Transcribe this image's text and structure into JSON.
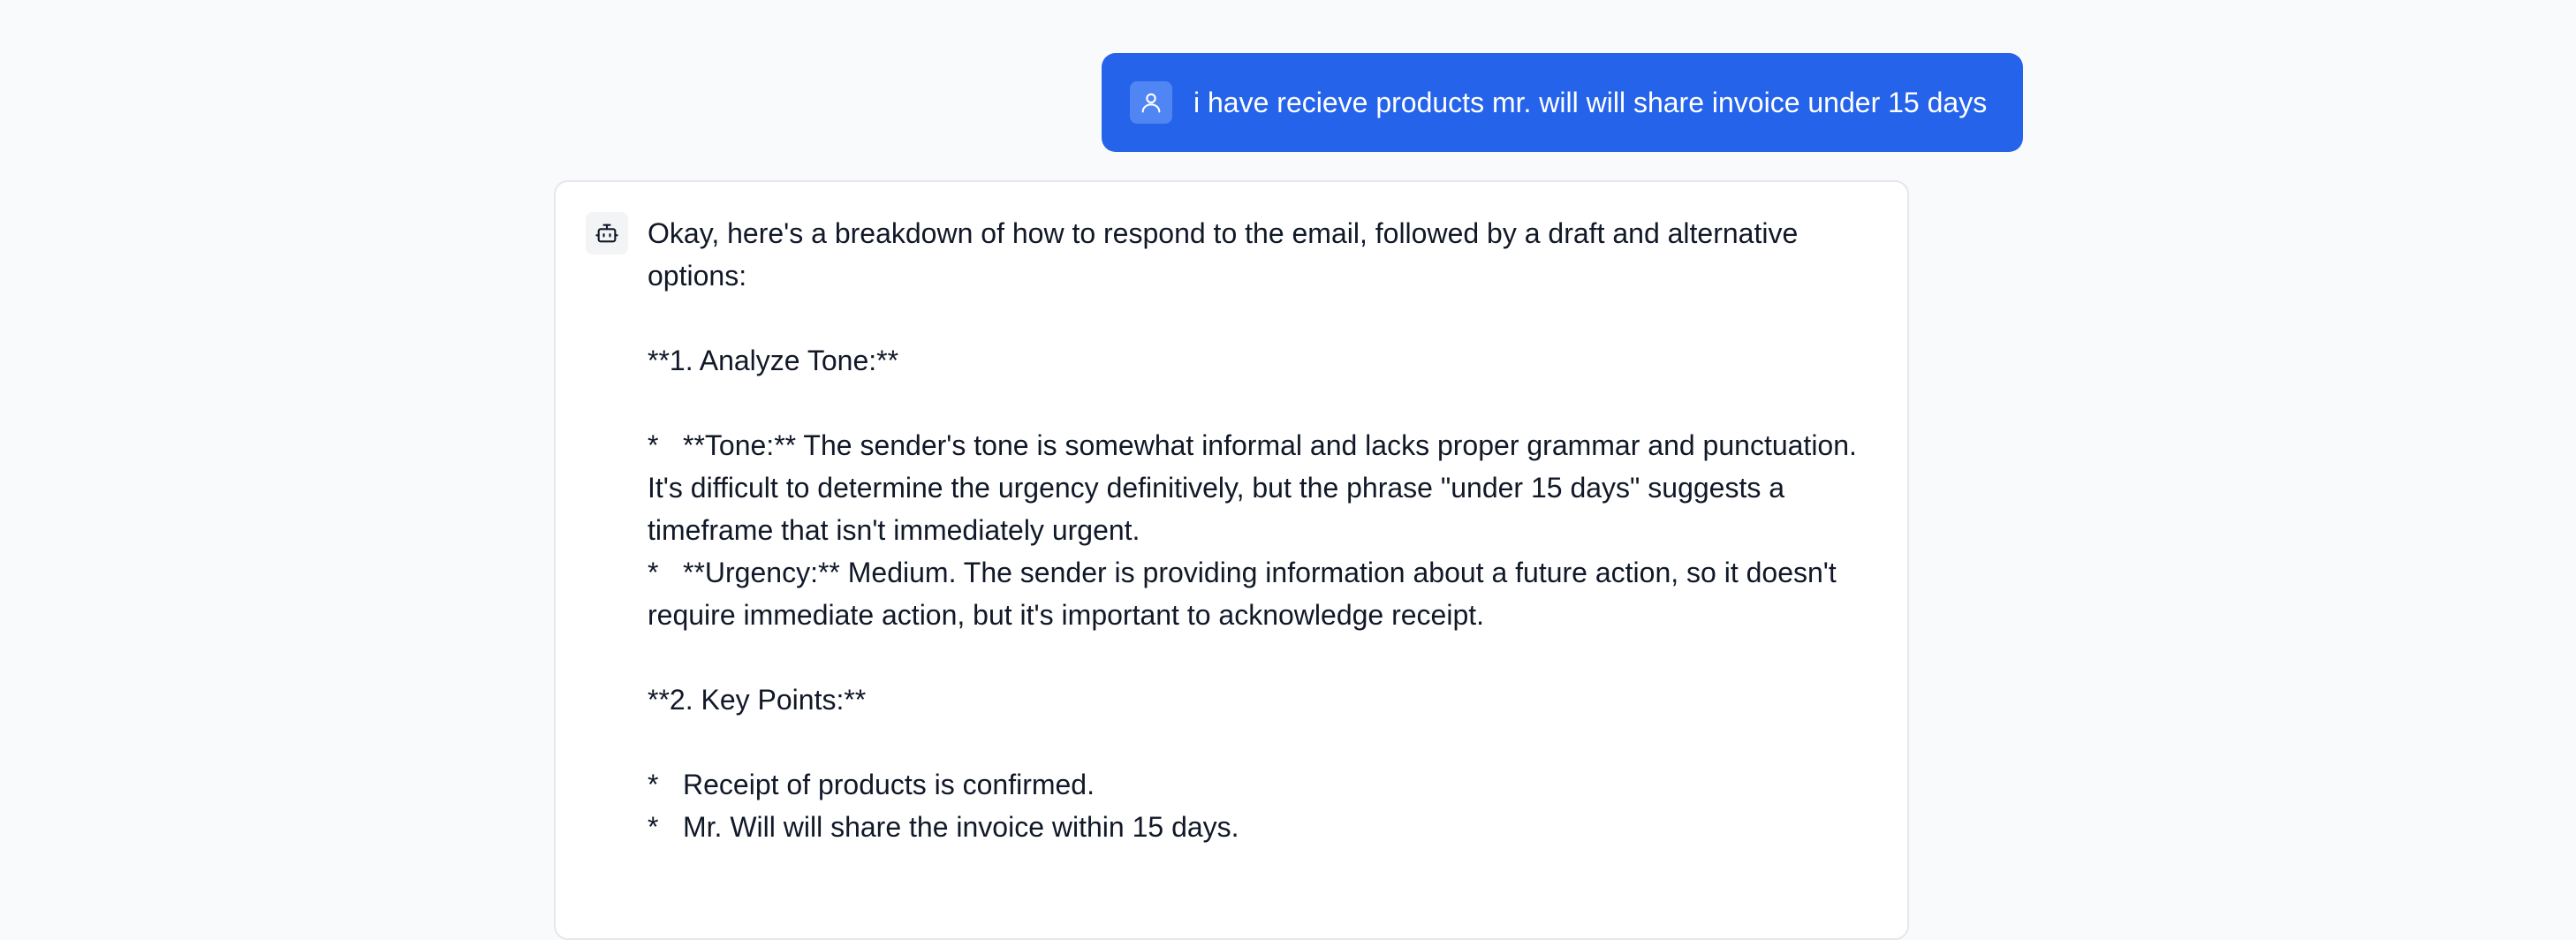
{
  "colors": {
    "user_bubble": "#2563eb",
    "page_background": "#f9fafb",
    "card_background": "#ffffff"
  },
  "icons": {
    "user": "user-icon",
    "bot": "bot-icon"
  },
  "user_message": {
    "text": "i have recieve products mr. will will share invoice under 15 days"
  },
  "assistant_message": {
    "intro": "Okay, here's a breakdown of how to respond to the email, followed by a draft and alternative options:",
    "section1_heading": "**1. Analyze Tone:**",
    "section1_bullets": [
      {
        "mark": "*",
        "text": "**Tone:** The sender's tone is somewhat informal and lacks proper grammar and punctuation. It's difficult to determine the urgency definitively, but the phrase \"under 15 days\" suggests a timeframe that isn't immediately urgent."
      },
      {
        "mark": "*",
        "text": "**Urgency:** Medium. The sender is providing information about a future action, so it doesn't require immediate action, but it's important to acknowledge receipt."
      }
    ],
    "section2_heading": "**2. Key Points:**",
    "section2_bullets": [
      {
        "mark": "*",
        "text": "Receipt of products is confirmed."
      },
      {
        "mark": "*",
        "text": "Mr. Will will share the invoice within 15 days."
      }
    ]
  }
}
